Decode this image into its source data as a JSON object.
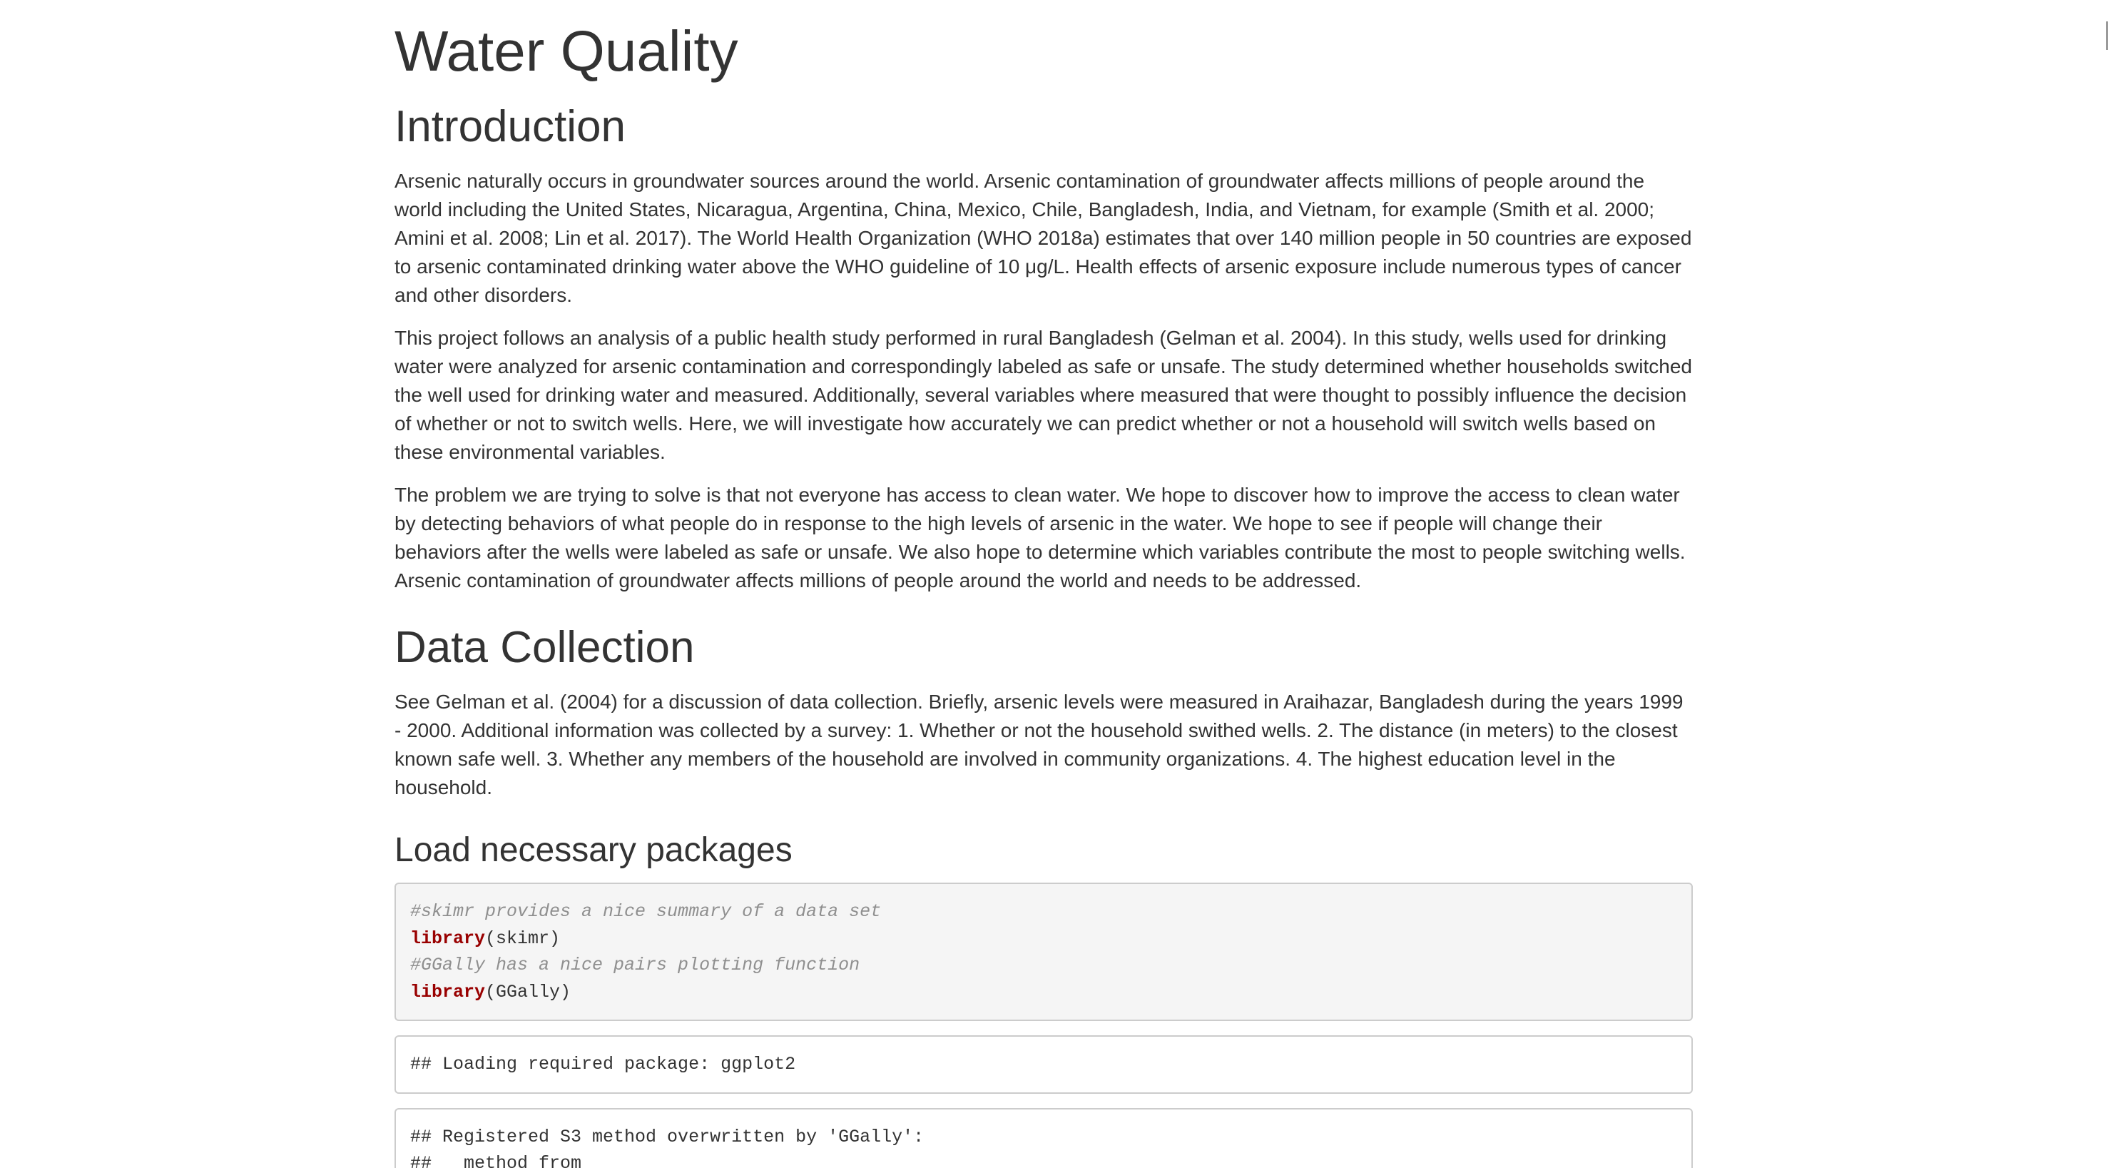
{
  "title": "Water Quality",
  "sections": {
    "introduction": {
      "heading": "Introduction",
      "paragraphs": [
        "Arsenic naturally occurs in groundwater sources around the world. Arsenic contamination of groundwater affects millions of people around the world including the United States, Nicaragua, Argentina, China, Mexico, Chile, Bangladesh, India, and Vietnam, for example (Smith et al. 2000; Amini et al. 2008; Lin et al. 2017). The World Health Organization (WHO 2018a) estimates that over 140 million people in 50 countries are exposed to arsenic contaminated drinking water above the WHO guideline of 10 μg/L. Health effects of arsenic exposure include numerous types of cancer and other disorders.",
        "This project follows an analysis of a public health study performed in rural Bangladesh (Gelman et al. 2004). In this study, wells used for drinking water were analyzed for arsenic contamination and correspondingly labeled as safe or unsafe. The study determined whether households switched the well used for drinking water and measured. Additionally, several variables where measured that were thought to possibly influence the decision of whether or not to switch wells. Here, we will investigate how accurately we can predict whether or not a household will switch wells based on these environmental variables.",
        "The problem we are trying to solve is that not everyone has access to clean water. We hope to discover how to improve the access to clean water by detecting behaviors of what people do in response to the high levels of arsenic in the water. We hope to see if people will change their behaviors after the wells were labeled as safe or unsafe. We also hope to determine which variables contribute the most to people switching wells. Arsenic contamination of groundwater affects millions of people around the world and needs to be addressed."
      ]
    },
    "data_collection": {
      "heading": "Data Collection",
      "paragraph": "See Gelman et al. (2004) for a discussion of data collection. Briefly, arsenic levels were measured in Araihazar, Bangladesh during the years 1999 - 2000. Additional information was collected by a survey: 1. Whether or not the household swithed wells. 2. The distance (in meters) to the closest known safe well. 3. Whether any members of the household are involved in community organizations. 4. The highest education level in the household."
    },
    "load_packages": {
      "heading": "Load necessary packages",
      "code": {
        "comment_1": "#skimr provides a nice summary of a data set",
        "kw_1": "library",
        "arg_1": "(skimr)",
        "comment_2": "#GGally has a nice pairs plotting function",
        "kw_2": "library",
        "arg_2": "(GGally)"
      },
      "output_1": "## Loading required package: ggplot2",
      "output_2": {
        "line_1": "## Registered S3 method overwritten by 'GGally':",
        "line_2": "##   method from"
      }
    }
  },
  "colors": {
    "text": "#333333",
    "code_keyword": "#990000",
    "code_comment": "#8f8f8f",
    "code_background": "#f5f5f5",
    "border": "#cccccc"
  }
}
